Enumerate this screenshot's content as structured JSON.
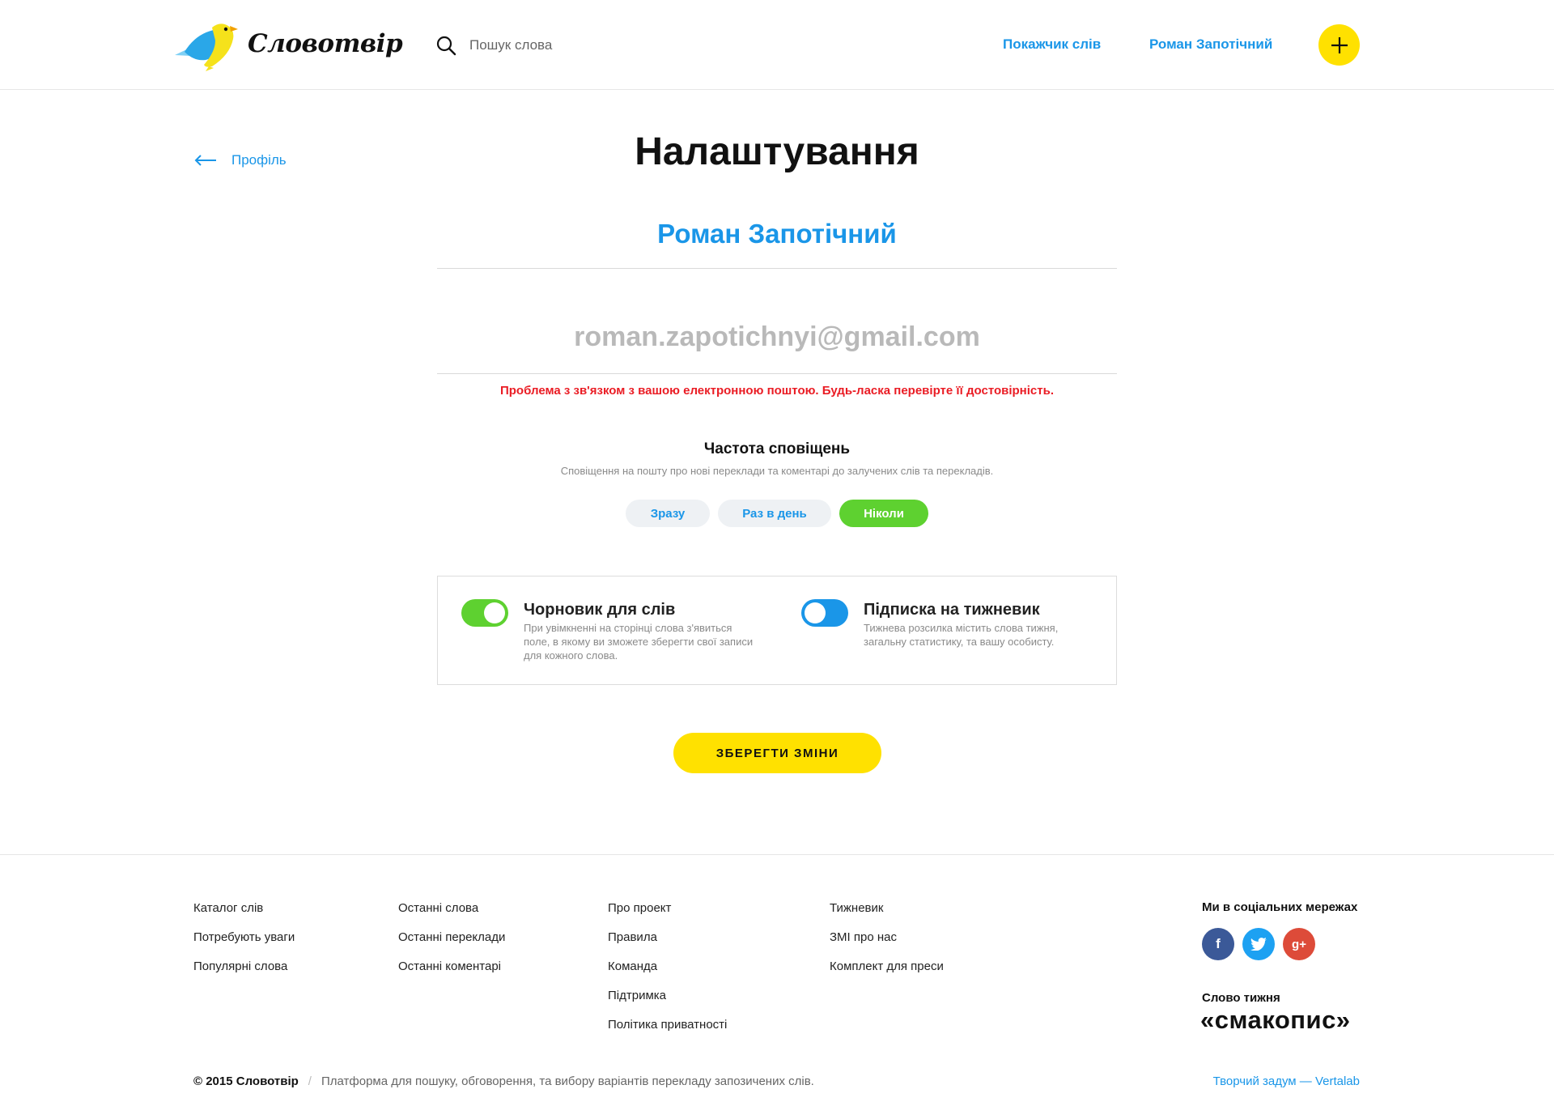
{
  "header": {
    "logo_text": "Словотвір",
    "search_placeholder": "Пошук слова",
    "nav": {
      "index_label": "Покажчик слів",
      "user_label": "Роман Запотічний"
    },
    "add_icon": "plus-icon"
  },
  "main": {
    "back_label": "Профіль",
    "title": "Налаштування",
    "user_name": "Роман Запотічний",
    "email_value": "roman.zapotichnyi@gmail.com",
    "error_message": "Проблема з зв'язком з вашою електронною поштою. Будь-ласка перевірте її достовірність.",
    "frequency": {
      "title": "Частота сповіщень",
      "description": "Сповіщення на пошту про нові переклади та коментарі до залучених слів та перекладів.",
      "options": [
        "Зразу",
        "Раз в день",
        "Ніколи"
      ],
      "selected": "Ніколи"
    },
    "options": [
      {
        "title": "Чорновик для слів",
        "description": "При увімкненні на сторінці слова з'явиться поле, в якому ви зможете зберегти свої записи для кожного слова.",
        "enabled": true,
        "color": "#5ed130"
      },
      {
        "title": "Підписка на тижневик",
        "description": "Тижнева розсилка містить слова тижня, загальну статистику, та вашу особисту.",
        "enabled": false,
        "color": "#1a96e8"
      }
    ],
    "save_label": "ЗБЕРЕГТИ ЗМІНИ"
  },
  "footer": {
    "columns": [
      [
        "Каталог слів",
        "Потребують уваги",
        "Популярні слова"
      ],
      [
        "Останні слова",
        "Останні переклади",
        "Останні коментарі"
      ],
      [
        "Про проект",
        "Правила",
        "Команда",
        "Підтримка",
        "Політика приватності"
      ],
      [
        "Тижневик",
        "ЗМІ про нас",
        "Комплект для преси"
      ]
    ],
    "social_title": "Ми в соціальних мережах",
    "social_icons": [
      "facebook-icon",
      "twitter-icon",
      "google-plus-icon"
    ],
    "word_of_week_title": "Слово тижня",
    "word_of_week": "«смакопис»",
    "copyright_brand": "© 2015 Словотвір",
    "separator": "/",
    "tagline": "Платформа для пошуку, обговорення, та вибору варіантів перекладу запозичених слів.",
    "credit": "Творчий задум — Vertalab"
  },
  "colors": {
    "accent_blue": "#1a96e8",
    "brand_yellow": "#ffe100",
    "toggle_green": "#5ed130",
    "error_red": "#ea1c24"
  }
}
